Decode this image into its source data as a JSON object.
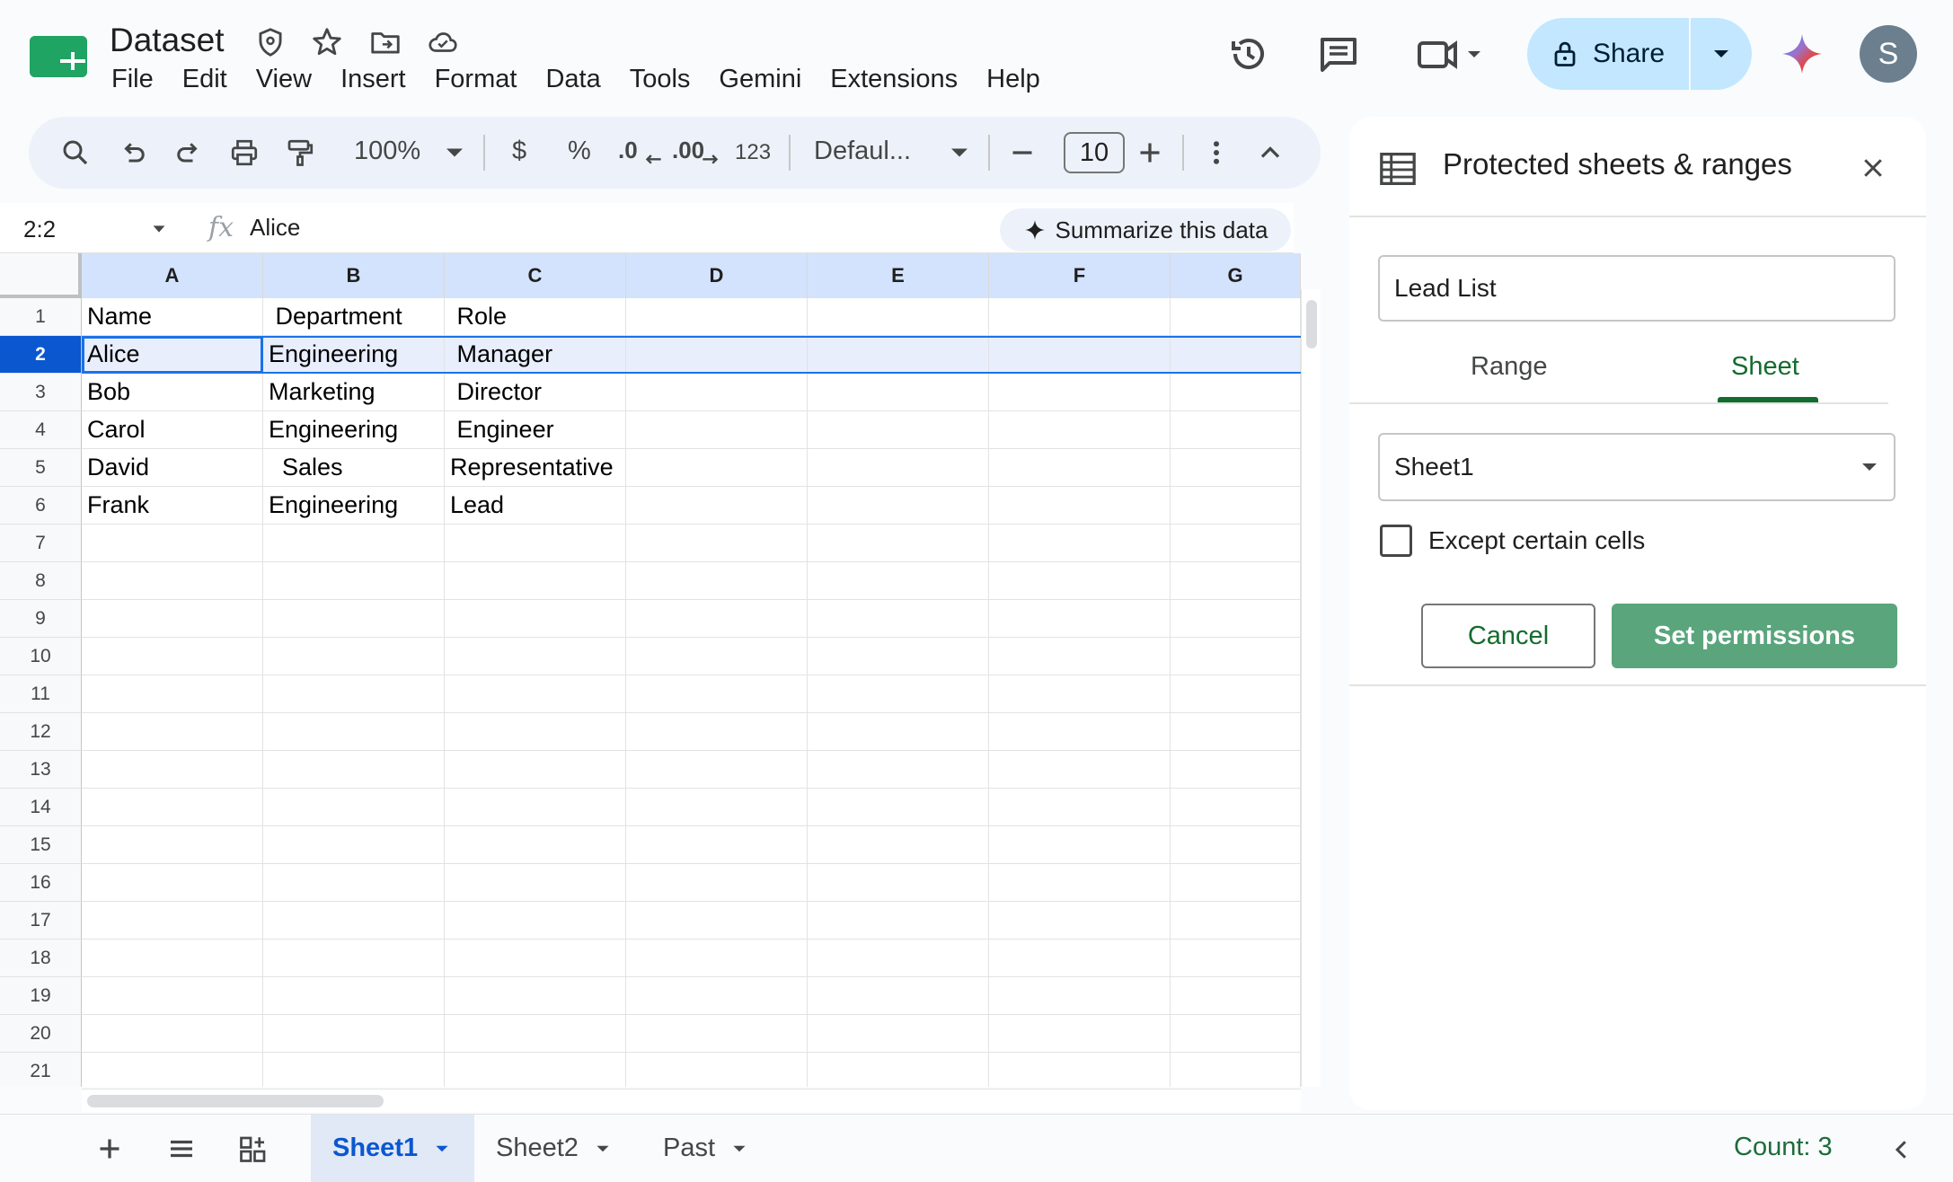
{
  "app": {
    "doc_title": "Dataset",
    "menus": [
      "File",
      "Edit",
      "View",
      "Insert",
      "Format",
      "Data",
      "Tools",
      "Gemini",
      "Extensions",
      "Help"
    ],
    "share_label": "Share",
    "avatar_initial": "S"
  },
  "toolbar": {
    "zoom": "100%",
    "currency": "$",
    "percent": "%",
    "dec_decrease": ".0",
    "dec_increase": ".00",
    "number_format": "123",
    "font": "Defaul...",
    "font_size": "10"
  },
  "formula_bar": {
    "name_box": "2:2",
    "fx": "fx",
    "value": "Alice",
    "summarize_label": "Summarize this data"
  },
  "grid": {
    "columns": [
      "A",
      "B",
      "C",
      "D",
      "E",
      "F",
      "G"
    ],
    "rows": [
      "1",
      "2",
      "3",
      "4",
      "5",
      "6",
      "7",
      "8",
      "9",
      "10",
      "11",
      "12",
      "13",
      "14",
      "15",
      "16",
      "17",
      "18",
      "19",
      "20",
      "21"
    ],
    "data": [
      [
        "Name",
        " Department",
        " Role"
      ],
      [
        "Alice",
        "Engineering",
        " Manager"
      ],
      [
        "Bob",
        "Marketing",
        " Director"
      ],
      [
        "Carol",
        "Engineering",
        " Engineer"
      ],
      [
        "David",
        "  Sales",
        "Representative"
      ],
      [
        "Frank",
        "Engineering",
        "Lead"
      ]
    ]
  },
  "panel": {
    "title": "Protected sheets & ranges",
    "description_value": "Lead List",
    "tab_range": "Range",
    "tab_sheet": "Sheet",
    "sheet_selected": "Sheet1",
    "except_label": "Except certain cells",
    "cancel_label": "Cancel",
    "set_permissions_label": "Set permissions"
  },
  "bottom": {
    "sheets": [
      "Sheet1",
      "Sheet2",
      "Past"
    ],
    "count": "Count: 3"
  },
  "colors": {
    "accent_green": "#146c2e",
    "share_bg": "#c2e7ff",
    "selection_blue": "#0b57d0",
    "set_permissions_bg": "#5aa57c"
  }
}
